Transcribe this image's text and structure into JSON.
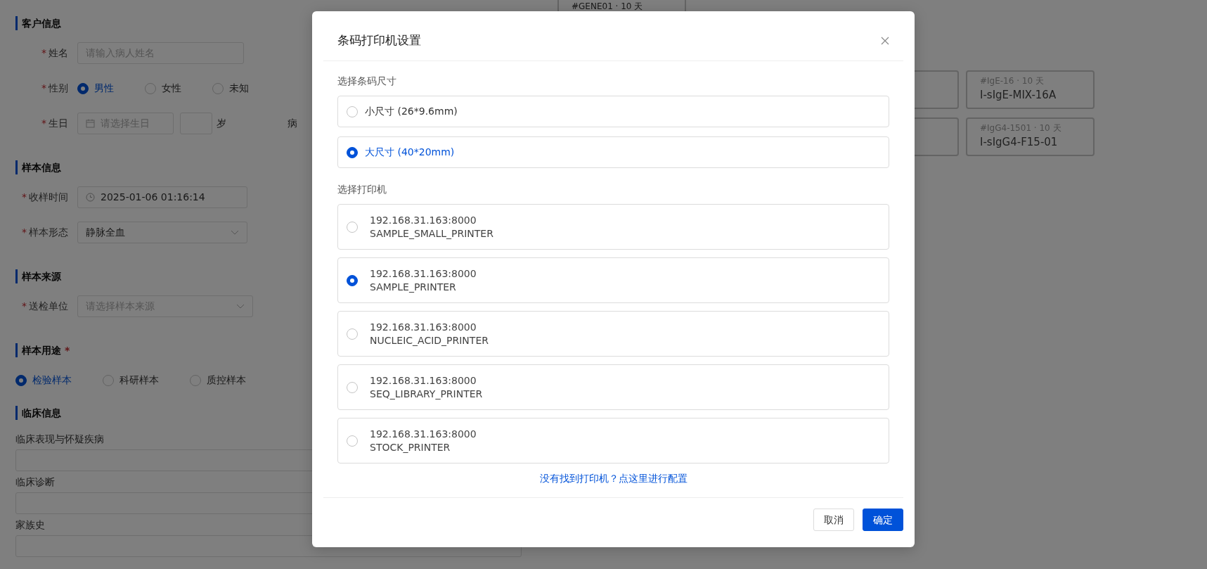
{
  "form": {
    "sections": [
      {
        "title": "客户信息",
        "rows": [
          {
            "kind": "input",
            "mark": "*",
            "label": "姓名",
            "placeholder": "请输入病人姓名"
          },
          {
            "kind": "radio",
            "mark": "*",
            "label": "性别",
            "options": [
              {
                "label": "男性",
                "selected": true
              },
              {
                "label": "女性",
                "selected": false
              },
              {
                "label": "未知",
                "selected": false
              }
            ]
          },
          {
            "kind": "date",
            "mark": "*",
            "label": "生日",
            "placeholder": "请选择生日",
            "suffix": "岁",
            "next_label": "病"
          }
        ]
      },
      {
        "title": "样本信息",
        "rows": [
          {
            "kind": "time",
            "mark": "*",
            "label": "收样时间",
            "value": "2025-01-06 01:16:14"
          },
          {
            "kind": "select",
            "mark": "*",
            "label": "样本形态",
            "value": "静脉全血"
          }
        ]
      },
      {
        "title": "样本来源",
        "rows": [
          {
            "kind": "select",
            "mark": "*",
            "label": "送检单位",
            "placeholder": "请选择样本来源"
          }
        ]
      },
      {
        "title": "样本用途",
        "mark": "*",
        "rows": [
          {
            "kind": "radio",
            "options": [
              {
                "label": "检验样本",
                "selected": true
              },
              {
                "label": "科研样本",
                "selected": false
              },
              {
                "label": "质控样本",
                "selected": false
              }
            ]
          }
        ]
      },
      {
        "title": "临床信息",
        "rows": [
          {
            "kind": "textarea",
            "label": "临床表现与怀疑疾病"
          },
          {
            "kind": "textarea",
            "label": "临床诊断"
          },
          {
            "kind": "textarea",
            "label": "家族史"
          }
        ]
      }
    ]
  },
  "top_card": {
    "code": "#GENE01 · 10 天"
  },
  "cards": [
    {
      "kind": "covered"
    },
    {
      "kind": "full",
      "code": "#IgE-16 · 10 天",
      "name": "I-sIgE-MIX-16A"
    },
    {
      "kind": "covered"
    },
    {
      "kind": "full",
      "code": "#IgG4-1501 · 10 天",
      "name": "I-sIgG4-F15-01"
    }
  ],
  "dialog": {
    "title": "条码打印机设置",
    "size_label": "选择条码尺寸",
    "sizes": [
      {
        "label": "小尺寸 (26*9.6mm)",
        "selected": false
      },
      {
        "label": "大尺寸 (40*20mm)",
        "selected": true
      }
    ],
    "printer_label": "选择打印机",
    "printers": [
      {
        "address": "192.168.31.163:8000",
        "name": "SAMPLE_SMALL_PRINTER",
        "selected": false
      },
      {
        "address": "192.168.31.163:8000",
        "name": "SAMPLE_PRINTER",
        "selected": true
      },
      {
        "address": "192.168.31.163:8000",
        "name": "NUCLEIC_ACID_PRINTER",
        "selected": false
      },
      {
        "address": "192.168.31.163:8000",
        "name": "SEQ_LIBRARY_PRINTER",
        "selected": false
      },
      {
        "address": "192.168.31.163:8000",
        "name": "STOCK_PRINTER",
        "selected": false
      }
    ],
    "help_link": "没有找到打印机？点这里进行配置",
    "buttons": [
      {
        "label": "取消",
        "kind": "secondary"
      },
      {
        "label": "确定",
        "kind": "primary"
      }
    ]
  }
}
